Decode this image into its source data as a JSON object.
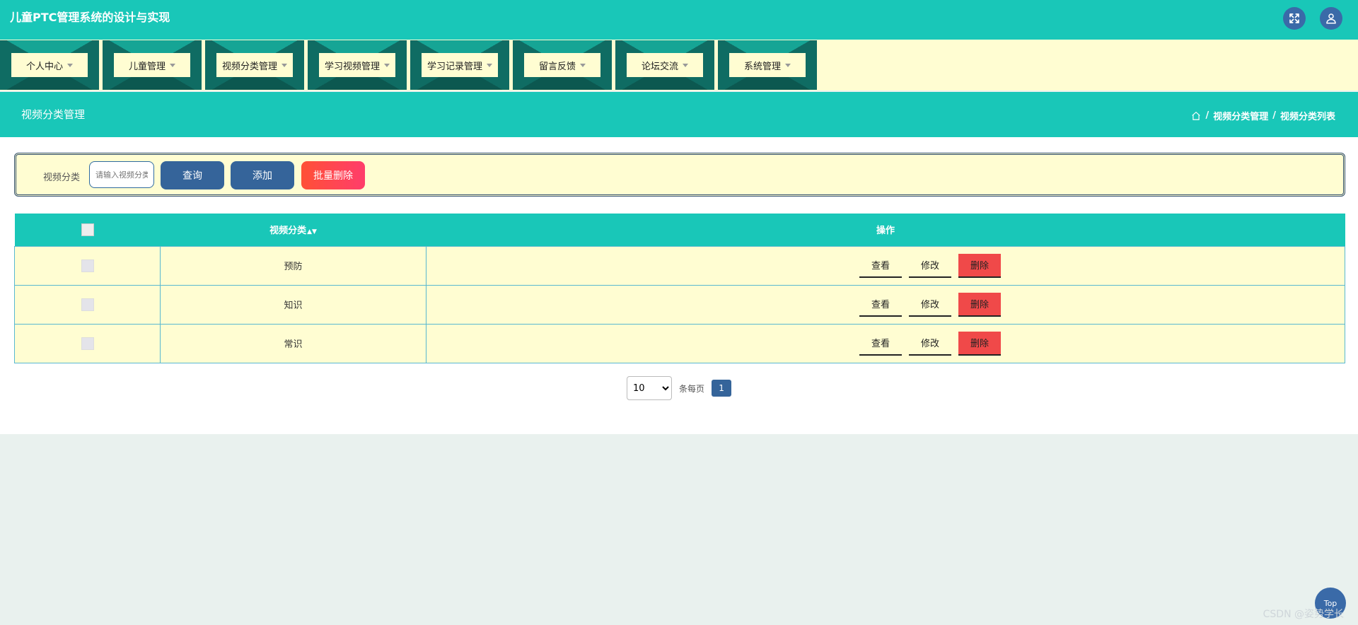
{
  "header": {
    "app_title": "儿童PTC管理系统的设计与实现",
    "icons": [
      "fullscreen-icon",
      "user-icon"
    ]
  },
  "nav": {
    "items": [
      {
        "label": "个人中心"
      },
      {
        "label": "儿童管理"
      },
      {
        "label": "视频分类管理"
      },
      {
        "label": "学习视频管理"
      },
      {
        "label": "学习记录管理"
      },
      {
        "label": "留言反馈"
      },
      {
        "label": "论坛交流"
      },
      {
        "label": "系统管理"
      }
    ]
  },
  "page": {
    "title": "视频分类管理",
    "breadcrumb": [
      "视频分类管理",
      "视频分类列表"
    ],
    "breadcrumb_sep": "/"
  },
  "search": {
    "label": "视频分类",
    "placeholder": "请输入视频分类",
    "query_label": "查询",
    "add_label": "添加",
    "bulk_delete_label": "批量删除"
  },
  "table": {
    "headers": [
      "视频分类",
      "操作"
    ],
    "rows": [
      {
        "name": "预防"
      },
      {
        "name": "知识"
      },
      {
        "name": "常识"
      }
    ],
    "actions": {
      "view": "查看",
      "edit": "修改",
      "delete": "删除"
    }
  },
  "pagination": {
    "page_size": "10",
    "page_size_suffix": "条每页",
    "current_page": "1"
  },
  "misc": {
    "top_label": "Top",
    "watermark": "CSDN @姿势学长"
  },
  "colors": {
    "primary": "#19c7b8",
    "button": "#35649a",
    "danger": "#f04949",
    "panel": "#fffdd2"
  }
}
